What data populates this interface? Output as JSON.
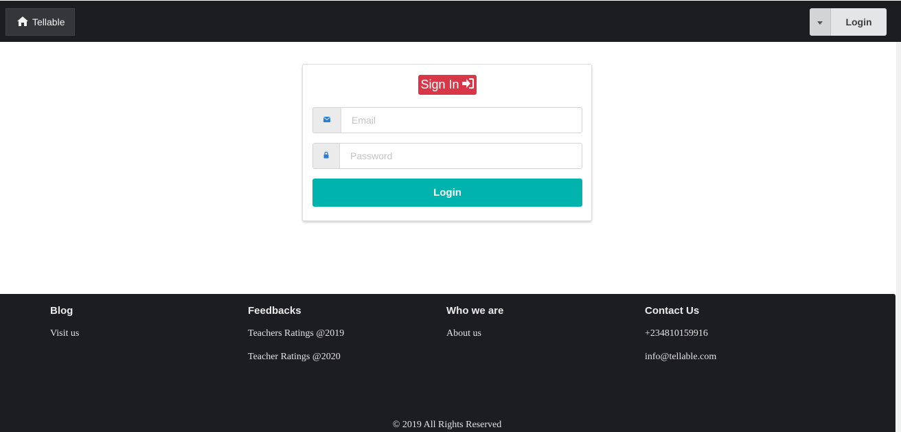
{
  "navbar": {
    "brand_label": "Tellable",
    "brand_icon": "home-icon",
    "login_label": "Login",
    "dropdown_icon": "caret-down-icon"
  },
  "signin": {
    "title": "Sign In",
    "title_icon": "sign-in-icon",
    "email_placeholder": "Email",
    "email_value": "",
    "email_icon": "envelope-icon",
    "password_placeholder": "Password",
    "password_value": "",
    "password_icon": "lock-icon",
    "submit_label": "Login"
  },
  "footer": {
    "columns": [
      {
        "heading": "Blog",
        "links": [
          "Visit us"
        ]
      },
      {
        "heading": "Feedbacks",
        "links": [
          "Teachers Ratings @2019",
          "Teacher Ratings @2020"
        ]
      },
      {
        "heading": "Who we are",
        "links": [
          "About us"
        ]
      },
      {
        "heading": "Contact Us",
        "links": [
          "+234810159916",
          "info@tellable.com"
        ]
      }
    ],
    "copyright": "© 2019 All Rights Reserved"
  },
  "colors": {
    "navbar_bg": "#1c1d20",
    "signin_badge": "#d83747",
    "login_button": "#00b3ad",
    "icon_blue": "#2a7fd4"
  }
}
